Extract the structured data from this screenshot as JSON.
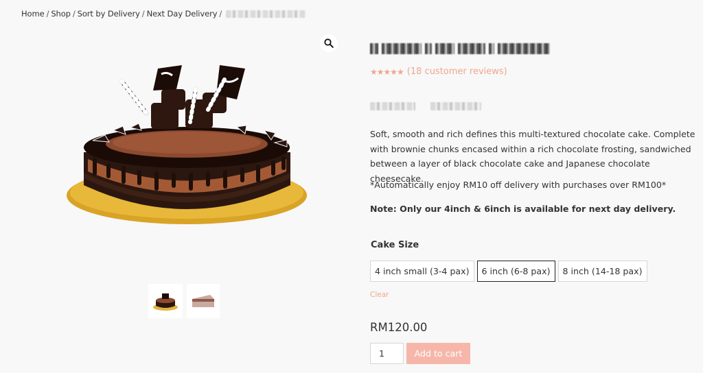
{
  "breadcrumb": {
    "items": [
      "Home",
      "Shop",
      "Sort by Delivery",
      "Next Day Delivery"
    ],
    "separator": "/"
  },
  "product": {
    "rating_stars": "★★★★★",
    "reviews_link": "(18 customer reviews)",
    "description": "Soft, smooth and rich defines this multi-textured chocolate cake. Complete with brownie chunks encased within a rich chocolate frosting, sandwiched between a layer of black chocolate cake and Japanese chocolate cheesecake.",
    "promo": "*Automatically enjoy RM10 off delivery with purchases over RM100*",
    "note": "Note: Only our 4inch & 6inch is available for next day delivery.",
    "size_label": "Cake Size",
    "sizes": [
      "4 inch small (3-4 pax)",
      "6 inch (6-8 pax)",
      "8 inch (14-18 pax)"
    ],
    "selected_size": "6 inch (6-8 pax)",
    "clear_label": "Clear",
    "price": "RM120.00",
    "quantity": "1",
    "add_to_cart": "Add to cart"
  },
  "icons": {
    "zoom": "magnifier-icon"
  },
  "colors": {
    "accent": "#f0a58f",
    "button": "#f6b7aa",
    "background": "#f8f8f8"
  }
}
